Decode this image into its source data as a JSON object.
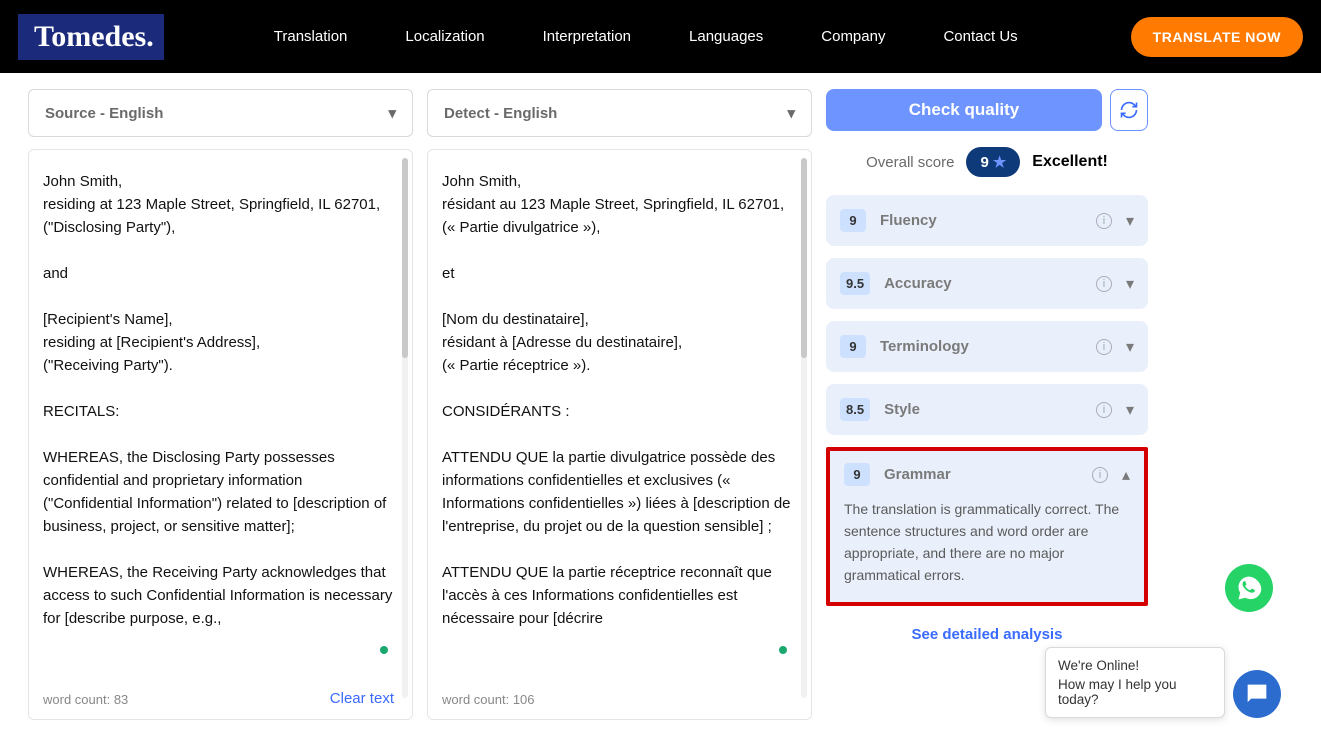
{
  "header": {
    "logo": "Tomedes.",
    "nav": [
      "Translation",
      "Localization",
      "Interpretation",
      "Languages",
      "Company",
      "Contact Us"
    ],
    "cta": "TRANSLATE NOW"
  },
  "source": {
    "lang_label": "Source - English",
    "text": "John Smith,\nresiding at 123 Maple Street, Springfield, IL 62701,\n(\"Disclosing Party\"),\n\nand\n\n[Recipient's Name],\nresiding at [Recipient's Address],\n(\"Receiving Party\").\n\nRECITALS:\n\nWHEREAS, the Disclosing Party possesses confidential and proprietary information (\"Confidential Information\") related to [description of business, project, or sensitive matter];\n\nWHEREAS, the Receiving Party acknowledges that access to such Confidential Information is necessary for [describe purpose, e.g.,",
    "word_count": "word count:  83",
    "clear": "Clear text"
  },
  "target": {
    "lang_label": "Detect - English",
    "text": "John Smith,\nrésidant au 123 Maple Street, Springfield, IL 62701,\n(« Partie divulgatrice »),\n\net\n\n[Nom du destinataire],\nrésidant à [Adresse du destinataire],\n(« Partie réceptrice »).\n\nCONSIDÉRANTS :\n\nATTENDU QUE la partie divulgatrice possède des informations confidentielles et exclusives (« Informations confidentielles ») liées à [description de l'entreprise, du projet ou de la question sensible] ;\n\nATTENDU QUE la partie réceptrice reconnaît que l'accès à ces Informations confidentielles est nécessaire pour [décrire",
    "word_count": "word count:  106"
  },
  "quality": {
    "check_btn": "Check quality",
    "overall_label": "Overall score",
    "overall_score": "9",
    "overall_word": "Excellent!",
    "metrics": [
      {
        "score": "9",
        "name": "Fluency"
      },
      {
        "score": "9.5",
        "name": "Accuracy"
      },
      {
        "score": "9",
        "name": "Terminology"
      },
      {
        "score": "8.5",
        "name": "Style"
      }
    ],
    "grammar": {
      "score": "9",
      "name": "Grammar",
      "desc": "The translation is grammatically correct. The sentence structures and word order are appropriate, and there are no major grammatical errors."
    },
    "detail_link": "See detailed analysis"
  },
  "chat": {
    "line1": "We're Online!",
    "line2": "How may I help you today?"
  }
}
